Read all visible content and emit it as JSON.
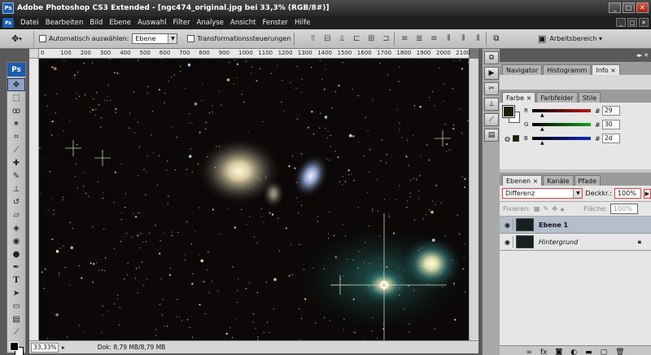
{
  "window": {
    "title": "Adobe Photoshop CS3 Extended - [ngc474_original.jpg bei 33,3% (RGB/8#)]",
    "app_badge": "Ps"
  },
  "menu": [
    "Datei",
    "Bearbeiten",
    "Bild",
    "Ebene",
    "Auswahl",
    "Filter",
    "Analyse",
    "Ansicht",
    "Fenster",
    "Hilfe"
  ],
  "options": {
    "auto_select_label": "Automatisch auswählen:",
    "auto_select_value": "Ebene",
    "transform_label": "Transformationssteuerungen",
    "workspace_label": "Arbeitsbereich ▾"
  },
  "ruler": {
    "ticks": [
      "0",
      "100",
      "200",
      "300",
      "400",
      "500",
      "600",
      "700",
      "800",
      "900",
      "1000",
      "1100",
      "1200",
      "1300",
      "1400",
      "1500",
      "1600",
      "1700",
      "1800",
      "1900",
      "2000",
      "2100"
    ]
  },
  "status": {
    "zoom": "33,33%",
    "doc": "Dok: 8,79 MB/8,79 MB"
  },
  "panel_top": {
    "tabs": [
      "Navigator",
      "Histogramm",
      "Info"
    ],
    "active": "Info"
  },
  "color_panel": {
    "tabs": [
      "Farbe",
      "Farbfelder",
      "Stile"
    ],
    "channels": [
      {
        "label": "R",
        "value": "29",
        "color": "#c01818"
      },
      {
        "label": "G",
        "value": "30",
        "color": "#18a018"
      },
      {
        "label": "B",
        "value": "2d",
        "color": "#1828c0"
      }
    ]
  },
  "layers_panel": {
    "tabs": [
      "Ebenen",
      "Kanäle",
      "Pfade"
    ],
    "blend_mode": "Differenz",
    "opacity_label": "Deckkr.:",
    "opacity_value": "100%",
    "lock_label": "Fixieren:",
    "fill_label": "Fläche:",
    "fill_value": "100%",
    "layers": [
      {
        "name": "Ebene 1",
        "selected": true
      },
      {
        "name": "Hintergrund",
        "selected": false
      }
    ]
  }
}
